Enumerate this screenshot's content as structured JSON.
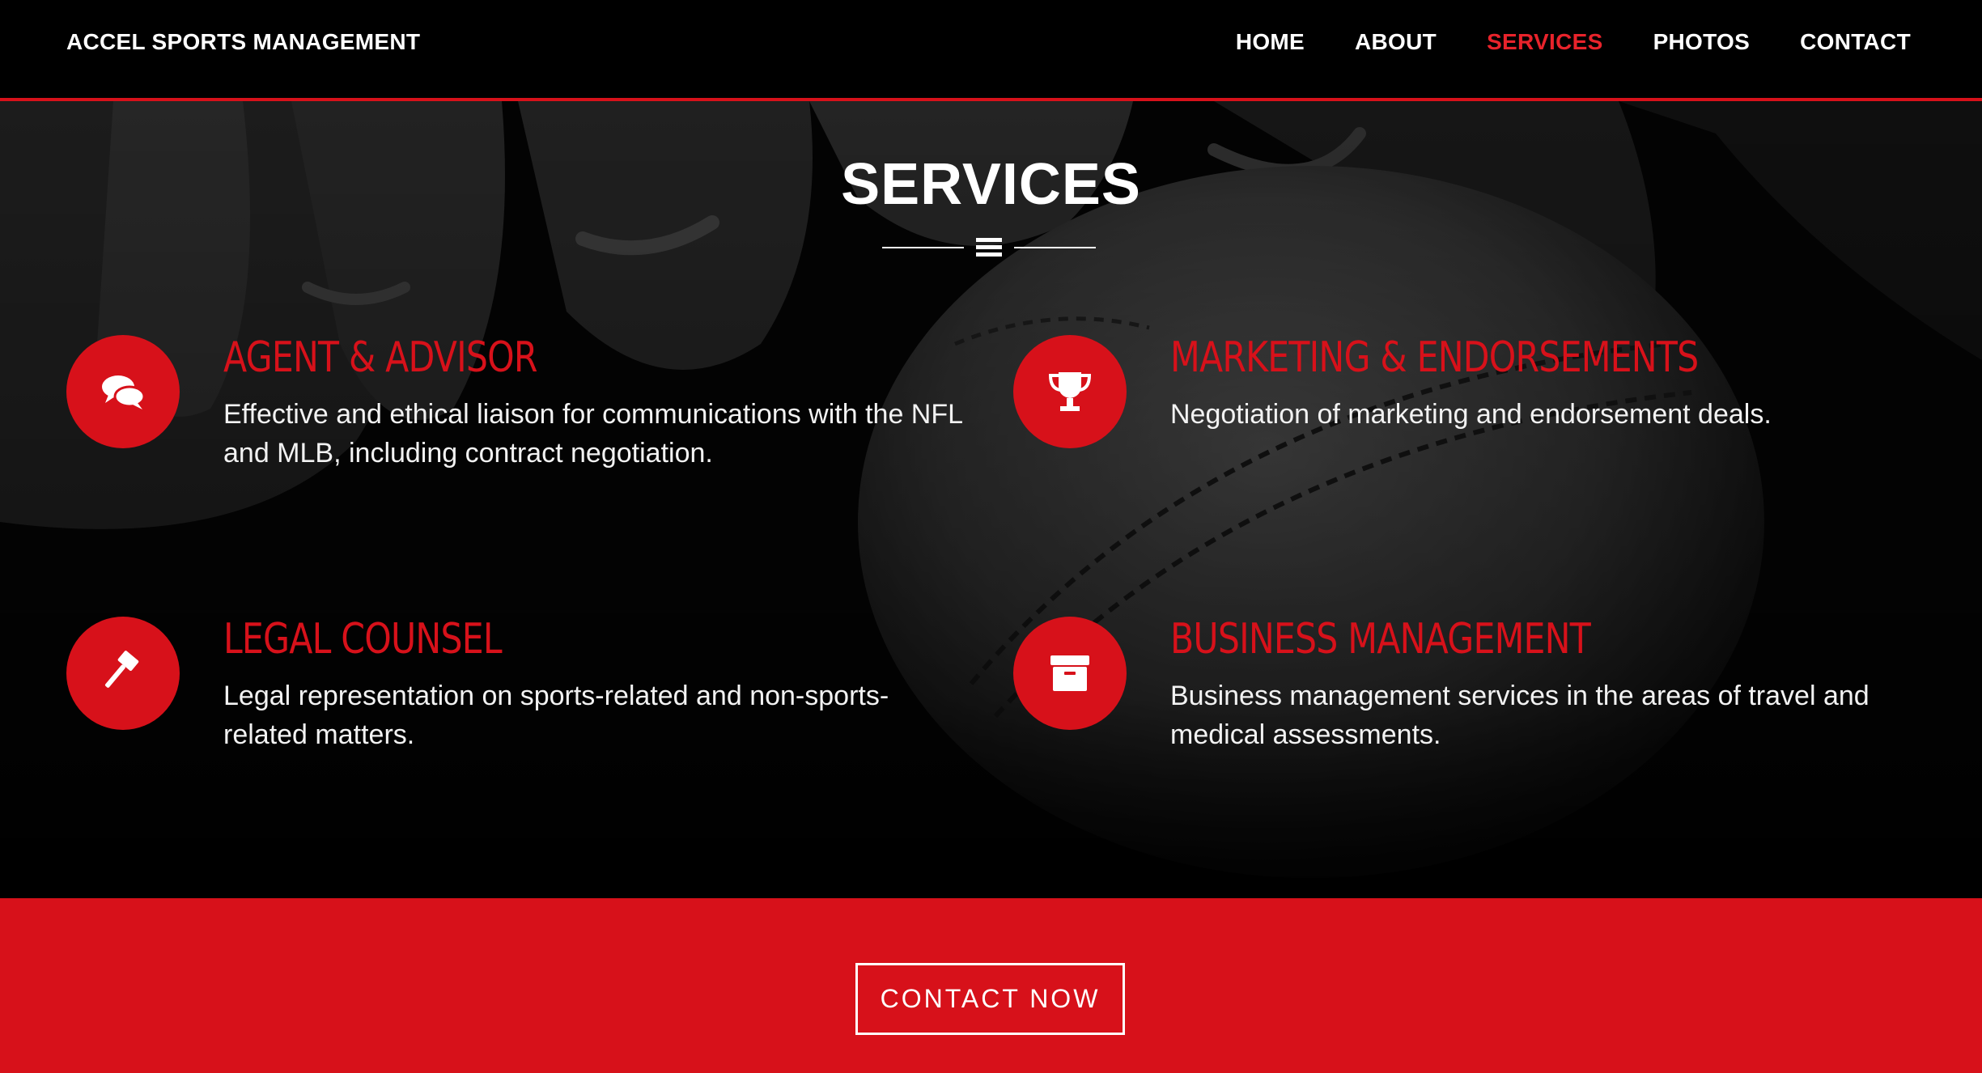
{
  "navbar": {
    "brand": "ACCEL SPORTS MANAGEMENT",
    "links": [
      "HOME",
      "ABOUT",
      "SERVICES",
      "PHOTOS",
      "CONTACT"
    ],
    "active_link": "SERVICES"
  },
  "services": {
    "title": "SERVICES",
    "divider_icon": "bars-icon",
    "items": [
      {
        "icon": "chat-bubbles-icon",
        "title": "AGENT & ADVISOR",
        "text": "Effective and ethical liaison for communications with the NFL and MLB, including contract negotiation."
      },
      {
        "icon": "trophy-icon",
        "title": "MARKETING & ENDORSEMENTS",
        "text": "Negotiation of marketing and endorsement deals."
      },
      {
        "icon": "gavel-icon",
        "title": "LEGAL COUNSEL",
        "text": "Legal representation on sports-related and non-sports-related matters."
      },
      {
        "icon": "archive-box-icon",
        "title": "BUSINESS MANAGEMENT",
        "text": "Business management services in the areas of travel and medical assessments."
      }
    ]
  },
  "cta": {
    "button_label": "CONTACT NOW"
  },
  "colors": {
    "accent": "#d7111a",
    "background": "#000000",
    "text": "#ffffff"
  }
}
